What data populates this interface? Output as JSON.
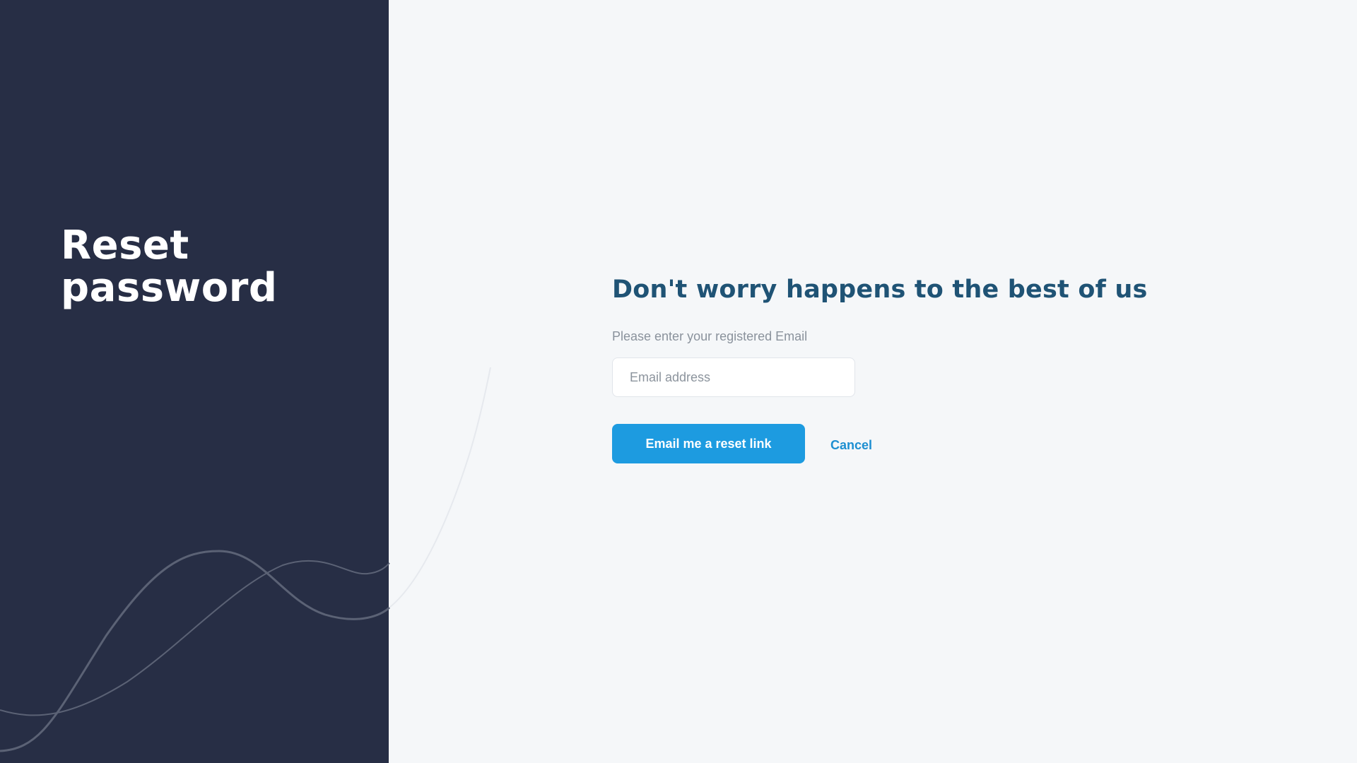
{
  "left_panel": {
    "title_line1": "Reset",
    "title_line2": "password"
  },
  "form": {
    "heading": "Don't worry happens to the best of us",
    "subtext": "Please enter your registered Email",
    "email_placeholder": "Email address",
    "email_value": "",
    "submit_label": "Email me a reset link",
    "cancel_label": "Cancel"
  },
  "colors": {
    "left_panel_bg": "#272e45",
    "page_bg": "#f5f7f9",
    "heading": "#1f5375",
    "primary": "#1d9be0",
    "link": "#1d8fd1"
  }
}
